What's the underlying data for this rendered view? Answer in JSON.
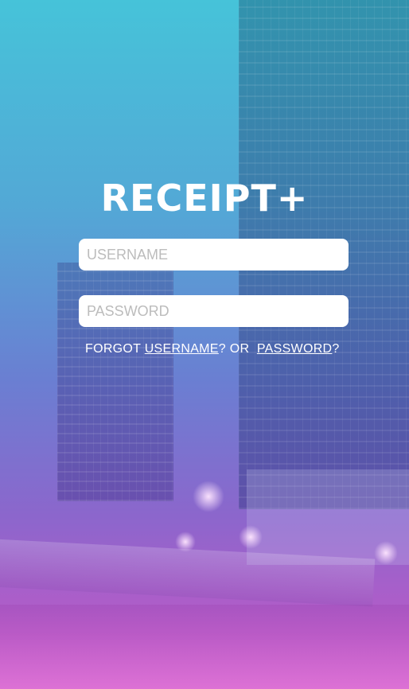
{
  "app": {
    "title": "RECEIPT+"
  },
  "login": {
    "username_placeholder": "USERNAME",
    "password_placeholder": "PASSWORD",
    "forgot_prefix": "FORGOT",
    "forgot_username_link": "USERNAME",
    "forgot_or": "? OR",
    "forgot_password_link": "PASSWORD",
    "forgot_suffix": "?"
  },
  "colors": {
    "gradient_top": "#46c3d9",
    "gradient_bottom": "#d56bd0",
    "text": "#ffffff",
    "field_background": "#ffffff",
    "placeholder": "#bcbcbc"
  }
}
